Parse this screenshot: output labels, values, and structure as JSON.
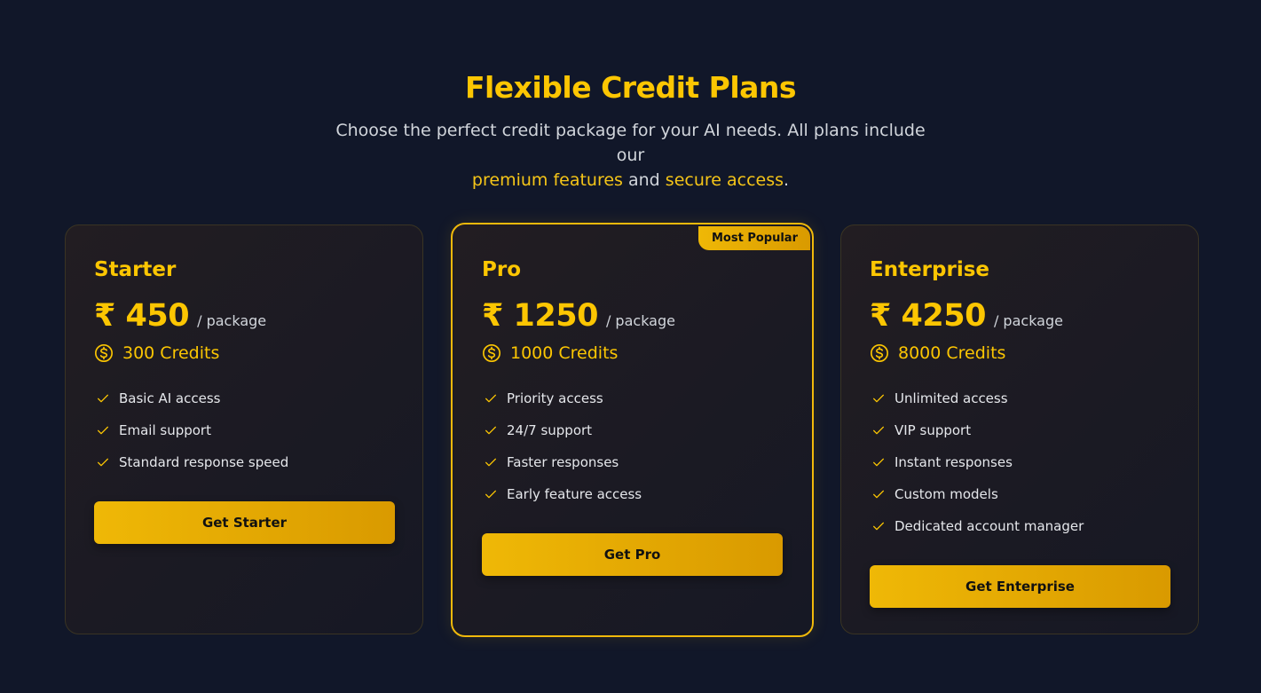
{
  "header": {
    "title": "Flexible Credit Plans",
    "subtitle_part1": "Choose the perfect credit package for your AI needs. All plans include our",
    "subtitle_hl1": "premium features",
    "subtitle_part2": "and",
    "subtitle_hl2": "secure access",
    "subtitle_part3": "."
  },
  "colors": {
    "background": "#111729",
    "accent": "#fcc602",
    "button_gradient_start": "#efb806",
    "button_gradient_end": "#d99a00"
  },
  "plans": [
    {
      "name": "Starter",
      "price": "₹ 450",
      "per": "/ package",
      "credits": "300 Credits",
      "features": [
        "Basic AI access",
        "Email support",
        "Standard response speed"
      ],
      "cta": "Get Starter",
      "featured": false
    },
    {
      "name": "Pro",
      "badge": "Most Popular",
      "price": "₹ 1250",
      "per": "/ package",
      "credits": "1000 Credits",
      "features": [
        "Priority access",
        "24/7 support",
        "Faster responses",
        "Early feature access"
      ],
      "cta": "Get Pro",
      "featured": true
    },
    {
      "name": "Enterprise",
      "price": "₹ 4250",
      "per": "/ package",
      "credits": "8000 Credits",
      "features": [
        "Unlimited access",
        "VIP support",
        "Instant responses",
        "Custom models",
        "Dedicated account manager"
      ],
      "cta": "Get Enterprise",
      "featured": false
    }
  ],
  "icons": {
    "credits": "dollar-coin-icon",
    "feature": "check-icon"
  }
}
